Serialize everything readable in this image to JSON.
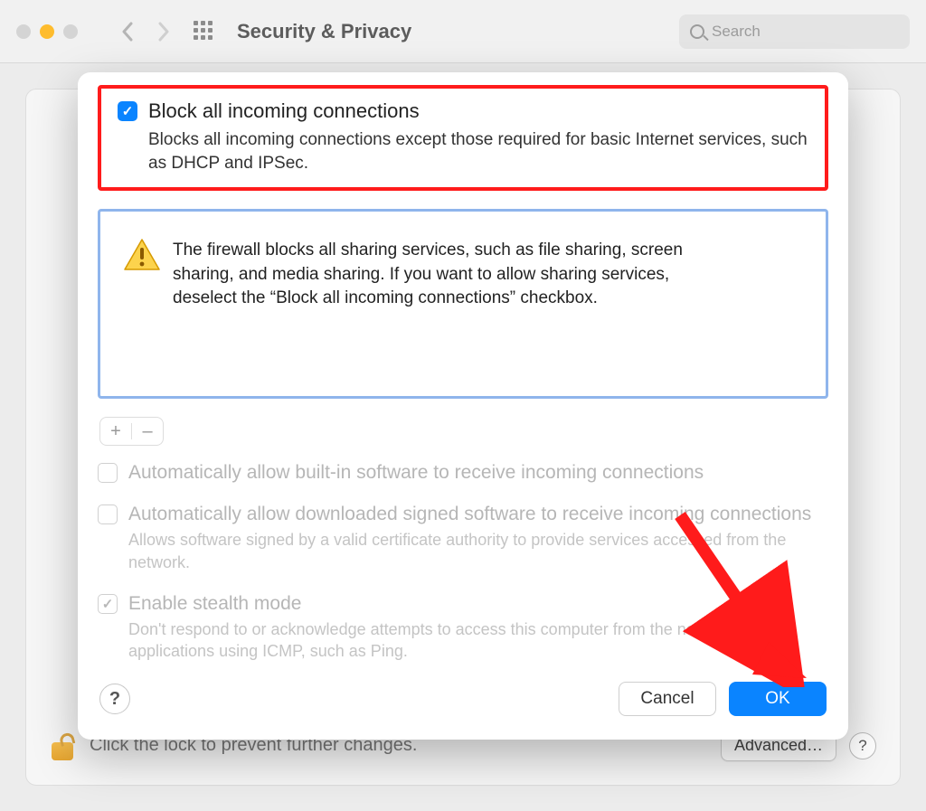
{
  "toolbar": {
    "title": "Security & Privacy",
    "search_placeholder": "Search"
  },
  "sheet": {
    "block_all": {
      "label": "Block all incoming connections",
      "desc": "Blocks all incoming connections except those required for basic Internet services, such as DHCP and IPSec."
    },
    "warning": "The firewall blocks all sharing services, such as file sharing, screen sharing, and media sharing. If you want to allow sharing services, deselect the “Block all incoming connections” checkbox.",
    "opt_builtin": {
      "label": "Automatically allow built-in software to receive incoming connections"
    },
    "opt_signed": {
      "label": "Automatically allow downloaded signed software to receive incoming connections",
      "desc": "Allows software signed by a valid certificate authority to provide services accessed from the network."
    },
    "opt_stealth": {
      "label": "Enable stealth mode",
      "desc": "Don't respond to or acknowledge attempts to access this computer from the network by test applications using ICMP, such as Ping."
    },
    "cancel": "Cancel",
    "ok": "OK",
    "help": "?",
    "plus": "+",
    "minus": "–"
  },
  "footer": {
    "lock_text": "Click the lock to prevent further changes.",
    "advanced": "Advanced…",
    "help": "?"
  }
}
